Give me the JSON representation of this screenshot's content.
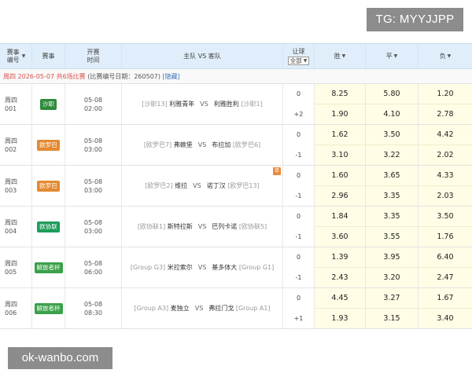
{
  "watermarks": {
    "top": "TG: MYYJJPP",
    "bottom": "ok-wanbo.com"
  },
  "header": {
    "match_no": "赛事编号",
    "league": "赛事",
    "time": "开赛时间",
    "matchup": "主队 VS 客队",
    "handicap": "让球",
    "handicap_select": "全部",
    "win": "胜",
    "draw": "平",
    "lose": "负"
  },
  "info": {
    "date_text": "周四 2026-05-07 共6场比赛",
    "issue_text": "(比赛编号日期：260507)",
    "hide_link": "[隐藏]"
  },
  "colors": {
    "accent": "#dfeefa",
    "info_red": "#d9534f",
    "odds_bg": "#fffde5"
  },
  "matches": [
    {
      "day": "周四",
      "num": "001",
      "league": "沙职",
      "league_color": "#2e8b3a",
      "date": "05-08",
      "time": "02:00",
      "home_tag": "[沙职13]",
      "home": "利雅青年",
      "vs": "VS",
      "away": "利雅胜利",
      "away_tag": "[沙职1]",
      "hot": "",
      "hc1": "0",
      "hc2": "+2",
      "w1": "8.25",
      "d1": "5.80",
      "l1": "1.20",
      "w2": "1.90",
      "d2": "4.10",
      "l2": "2.78"
    },
    {
      "day": "周四",
      "num": "002",
      "league": "欧罗巴",
      "league_color": "#e48a32",
      "date": "05-08",
      "time": "03:00",
      "home_tag": "[欧罗巴7]",
      "home": "弗赖堡",
      "vs": "VS",
      "away": "布拉加",
      "away_tag": "[欧罗巴6]",
      "hot": "",
      "hc1": "0",
      "hc2": "-1",
      "w1": "1.62",
      "d1": "3.50",
      "l1": "4.42",
      "w2": "3.10",
      "d2": "3.22",
      "l2": "2.02"
    },
    {
      "day": "周四",
      "num": "003",
      "league": "欧罗巴",
      "league_color": "#e48a32",
      "date": "05-08",
      "time": "03:00",
      "home_tag": "[欧罗巴2]",
      "home": "维拉",
      "vs": "VS",
      "away": "诺丁汉",
      "away_tag": "[欧罗巴13]",
      "hot": "单",
      "hc1": "0",
      "hc2": "-1",
      "w1": "1.60",
      "d1": "3.65",
      "l1": "4.33",
      "w2": "2.96",
      "d2": "3.35",
      "l2": "2.03"
    },
    {
      "day": "周四",
      "num": "004",
      "league": "欧协联",
      "league_color": "#1e9c5a",
      "date": "05-08",
      "time": "03:00",
      "home_tag": "[欧协联1]",
      "home": "斯特拉斯",
      "vs": "VS",
      "away": "巴列卡诺",
      "away_tag": "[欧协联5]",
      "hot": "",
      "hc1": "0",
      "hc2": "-1",
      "w1": "1.84",
      "d1": "3.35",
      "l1": "3.50",
      "w2": "3.60",
      "d2": "3.55",
      "l2": "1.76"
    },
    {
      "day": "周四",
      "num": "005",
      "league": "解放者杯",
      "league_color": "#3aa14a",
      "date": "05-08",
      "time": "06:00",
      "home_tag": "[Group G3]",
      "home": "米拉索尔",
      "vs": "VS",
      "away": "基多体大",
      "away_tag": "[Group G1]",
      "hot": "",
      "hc1": "0",
      "hc2": "-1",
      "w1": "1.39",
      "d1": "3.95",
      "l1": "6.40",
      "w2": "2.43",
      "d2": "3.20",
      "l2": "2.47"
    },
    {
      "day": "周四",
      "num": "006",
      "league": "解放者杯",
      "league_color": "#3aa14a",
      "date": "05-08",
      "time": "08:30",
      "home_tag": "[Group A3]",
      "home": "麦独立",
      "vs": "VS",
      "away": "弗拉门戈",
      "away_tag": "[Group A1]",
      "hot": "",
      "hc1": "0",
      "hc2": "+1",
      "w1": "4.45",
      "d1": "3.27",
      "l1": "1.67",
      "w2": "1.93",
      "d2": "3.15",
      "l2": "3.40"
    }
  ]
}
